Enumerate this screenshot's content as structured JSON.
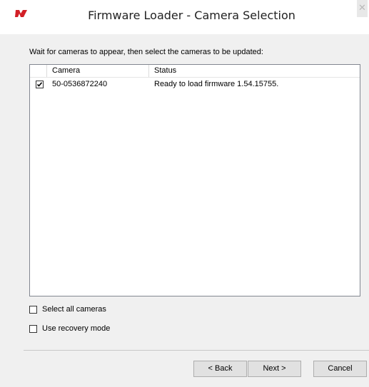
{
  "window": {
    "title": "Firmware Loader - Camera Selection",
    "close_glyph": "✕",
    "logo_icon": "flir-logo-icon",
    "logo_color": "#d21f26"
  },
  "instruction": "Wait for cameras to appear, then select the cameras to be updated:",
  "camera_list": {
    "columns": [
      "Camera",
      "Status"
    ],
    "rows": [
      {
        "checked": true,
        "camera": "50-0536872240",
        "status": "Ready to load firmware 1.54.15755."
      }
    ]
  },
  "options": {
    "select_all": {
      "label": "Select all cameras",
      "checked": false
    },
    "recovery_mode": {
      "label": "Use recovery mode",
      "checked": false
    }
  },
  "buttons": {
    "back": "< Back",
    "next": "Next >",
    "cancel": "Cancel"
  }
}
